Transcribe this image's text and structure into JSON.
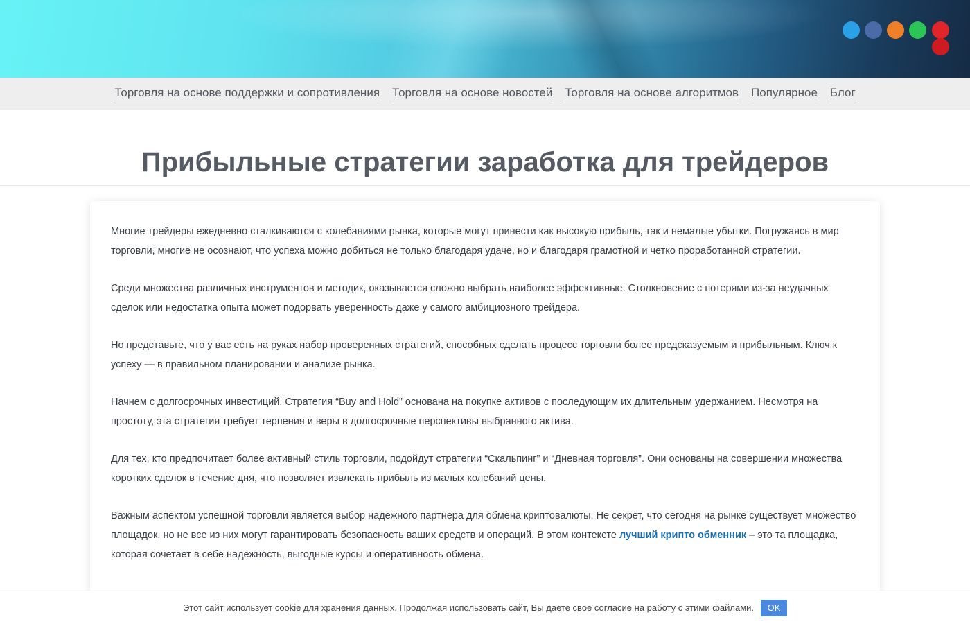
{
  "colors": {
    "dots": [
      "#2aa0e6",
      "#4a6aa8",
      "#f08028",
      "#2dc458",
      "#e0262a",
      "#cc1c22"
    ],
    "link": "#1a6fb0",
    "ok_button": "#4b89e0"
  },
  "nav": {
    "items": [
      "Торговля на основе поддержки и сопротивления",
      "Торговля на основе новостей",
      "Торговля на основе алгоритмов",
      "Популярное",
      "Блог"
    ]
  },
  "page": {
    "title": "Прибыльные стратегии заработка для трейдеров"
  },
  "article": {
    "p1": "Многие трейдеры ежедневно сталкиваются с колебаниями рынка, которые могут принести как высокую прибыль, так и немалые убытки. Погружаясь в мир торговли, многие не осознают, что успеха можно добиться не только благодаря удаче, но и благодаря грамотной и четко проработанной стратегии.",
    "p2": "Среди множества различных инструментов и методик, оказывается сложно выбрать наиболее эффективные. Столкновение с потерями из-за неудачных сделок или недостатка опыта может подорвать уверенность даже у самого амбициозного трейдера.",
    "p3": "Но представьте, что у вас есть на руках набор проверенных стратегий, способных сделать процесс торговли более предсказуемым и прибыльным. Ключ к успеху — в правильном планировании и анализе рынка.",
    "p4": "Начнем с долгосрочных инвестиций. Стратегия “Buy and Hold” основана на покупке активов с последующим их длительным удержанием. Несмотря на простоту, эта стратегия требует терпения и веры в долгосрочные перспективы выбранного актива.",
    "p5": "Для тех, кто предпочитает более активный стиль торговли, подойдут стратегии “Скальпинг” и “Дневная торговля”. Они основаны на совершении множества коротких сделок в течение дня, что позволяет извлекать прибыль из малых колебаний цены.",
    "p6_before": "Важным аспектом успешной торговли является выбор надежного партнера для обмена криптовалюты. Не секрет, что сегодня на рынке существует множество площадок, но не все из них могут гарантировать безопасность ваших средств и операций. В этом контексте ",
    "p6_link": "лучший крипто обменник",
    "p6_after": " – это та площадка, которая сочетает в себе надежность, выгодные курсы и оперативность обмена."
  },
  "cookie": {
    "text": "Этот сайт использует cookie для хранения данных. Продолжая использовать сайт, Вы даете свое согласие на работу с этими файлами.",
    "button": "OK"
  }
}
